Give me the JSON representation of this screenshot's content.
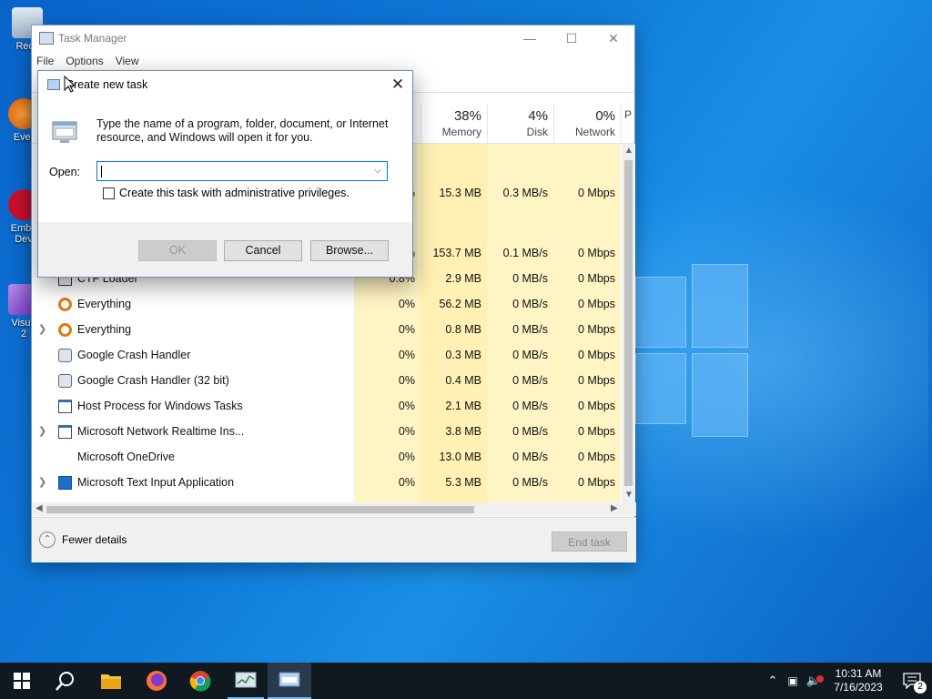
{
  "desktop": {
    "icons": [
      {
        "label": "Recy"
      },
      {
        "label": "Ever"
      },
      {
        "label": "Emba"
      },
      {
        "label": "Dev"
      },
      {
        "label": "Visua"
      },
      {
        "label": "2"
      }
    ]
  },
  "taskmanager": {
    "title": "Task Manager",
    "menu": [
      "File",
      "Options",
      "View"
    ],
    "columns": [
      {
        "pct": "38%",
        "label": "Memory"
      },
      {
        "pct": "4%",
        "label": "Disk"
      },
      {
        "pct": "0%",
        "label": "Network"
      },
      {
        "pct": "",
        "label": "P"
      }
    ],
    "partial_rows": [
      {
        "cpu": "%",
        "mem": "15.3 MB",
        "disk": "0.3 MB/s",
        "net": "0 Mbps"
      },
      {
        "cpu": "%",
        "mem": "153.7 MB",
        "disk": "0.1 MB/s",
        "net": "0 Mbps"
      }
    ],
    "rows": [
      {
        "name": "CTF Loader",
        "cpu": "0.8%",
        "mem": "2.9 MB",
        "disk": "0 MB/s",
        "net": "0 Mbps",
        "expand": false
      },
      {
        "name": "Everything",
        "cpu": "0%",
        "mem": "56.2 MB",
        "disk": "0 MB/s",
        "net": "0 Mbps",
        "expand": false
      },
      {
        "name": "Everything",
        "cpu": "0%",
        "mem": "0.8 MB",
        "disk": "0 MB/s",
        "net": "0 Mbps",
        "expand": true
      },
      {
        "name": "Google Crash Handler",
        "cpu": "0%",
        "mem": "0.3 MB",
        "disk": "0 MB/s",
        "net": "0 Mbps",
        "expand": false
      },
      {
        "name": "Google Crash Handler (32 bit)",
        "cpu": "0%",
        "mem": "0.4 MB",
        "disk": "0 MB/s",
        "net": "0 Mbps",
        "expand": false
      },
      {
        "name": "Host Process for Windows Tasks",
        "cpu": "0%",
        "mem": "2.1 MB",
        "disk": "0 MB/s",
        "net": "0 Mbps",
        "expand": false
      },
      {
        "name": "Microsoft Network Realtime Ins...",
        "cpu": "0%",
        "mem": "3.8 MB",
        "disk": "0 MB/s",
        "net": "0 Mbps",
        "expand": true
      },
      {
        "name": "Microsoft OneDrive",
        "cpu": "0%",
        "mem": "13.0 MB",
        "disk": "0 MB/s",
        "net": "0 Mbps",
        "expand": false
      },
      {
        "name": "Microsoft Text Input Application",
        "cpu": "0%",
        "mem": "5.3 MB",
        "disk": "0 MB/s",
        "net": "0 Mbps",
        "expand": true
      }
    ],
    "fewer_details": "Fewer details",
    "end_task": "End task"
  },
  "dialog": {
    "title": "Create new task",
    "description": "Type the name of a program, folder, document, or Internet resource, and Windows will open it for you.",
    "open_label": "Open:",
    "open_value": "",
    "admin_checkbox": "Create this task with administrative privileges.",
    "admin_checked": false,
    "ok": "OK",
    "cancel": "Cancel",
    "browse": "Browse..."
  },
  "taskbar": {
    "time": "10:31 AM",
    "date": "7/16/2023",
    "notifications": "2"
  },
  "colors": {
    "accent": "#0078d7",
    "cpu_highlight": "#fff4c4",
    "mem_highlight": "#fff0b3"
  }
}
